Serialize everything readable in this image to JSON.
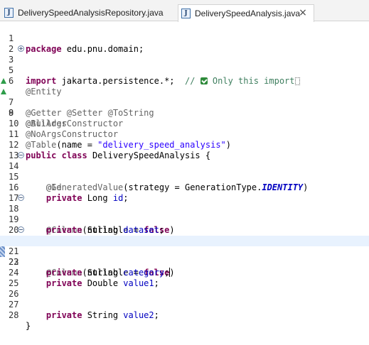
{
  "tabs": [
    {
      "label": "DeliverySpeedAnalysisRepository.java",
      "icon": "java-file-icon",
      "active": false
    },
    {
      "label": "DeliverySpeedAnalysis.java",
      "icon": "java-file-icon",
      "active": true,
      "close": "×"
    }
  ],
  "file_icon_letter": "J",
  "editor": {
    "line_numbers": [
      "1",
      "2",
      "3",
      "5",
      "6",
      "7",
      "8",
      "9",
      "10",
      "11",
      "12",
      "13",
      "14",
      "15",
      "16",
      "17",
      "18",
      "19",
      "20",
      "21",
      "22",
      "23",
      "24",
      "25",
      "26",
      "27",
      "28"
    ],
    "line1": {
      "kw": "package",
      "rest": " edu.pnu.domain;"
    },
    "line3": {
      "kw": "import",
      "rest": " jakarta.persistence.*;  ",
      "comment_a": "// ",
      "comment_b": " Only this import",
      "comment_c": "."
    },
    "line6": "@Entity",
    "line7": "@Getter @Setter @ToString",
    "line8": "@Builder",
    "line9": "@AllArgsConstructor",
    "line10": "@NoArgsConstructor",
    "line11": {
      "ann": "@Table",
      "a": "(name = ",
      "str": "\"delivery_speed_analysis\"",
      "b": ")"
    },
    "line12": {
      "kw1": "public",
      "kw2": "class",
      "rest": " DeliverySpeedAnalysis {"
    },
    "line14": "@Id",
    "line15": {
      "ann": "@GeneratedValue",
      "a": "(strategy = GenerationType.",
      "const": "IDENTITY",
      "b": ")"
    },
    "line16": {
      "kw": "private",
      "type": " Long ",
      "field": "id",
      "end": ";"
    },
    "line18": {
      "ann": "@Column",
      "a": "(nullable = ",
      "kw": "false",
      "b": ")"
    },
    "line19": {
      "kw": "private",
      "type": " String ",
      "field": "dataset",
      "end": ";"
    },
    "line21": {
      "ann": "@Column",
      "a": "(nullable = ",
      "kw": "false",
      "b": ")"
    },
    "line22": {
      "kw": "private",
      "type": " String ",
      "field": "category",
      "end": ";"
    },
    "line24": {
      "kw": "private",
      "type": " Double ",
      "field": "value1",
      "end": ";"
    },
    "line27": {
      "kw": "private",
      "type": " String ",
      "field": "value2",
      "end": ";"
    },
    "line28": "}"
  }
}
